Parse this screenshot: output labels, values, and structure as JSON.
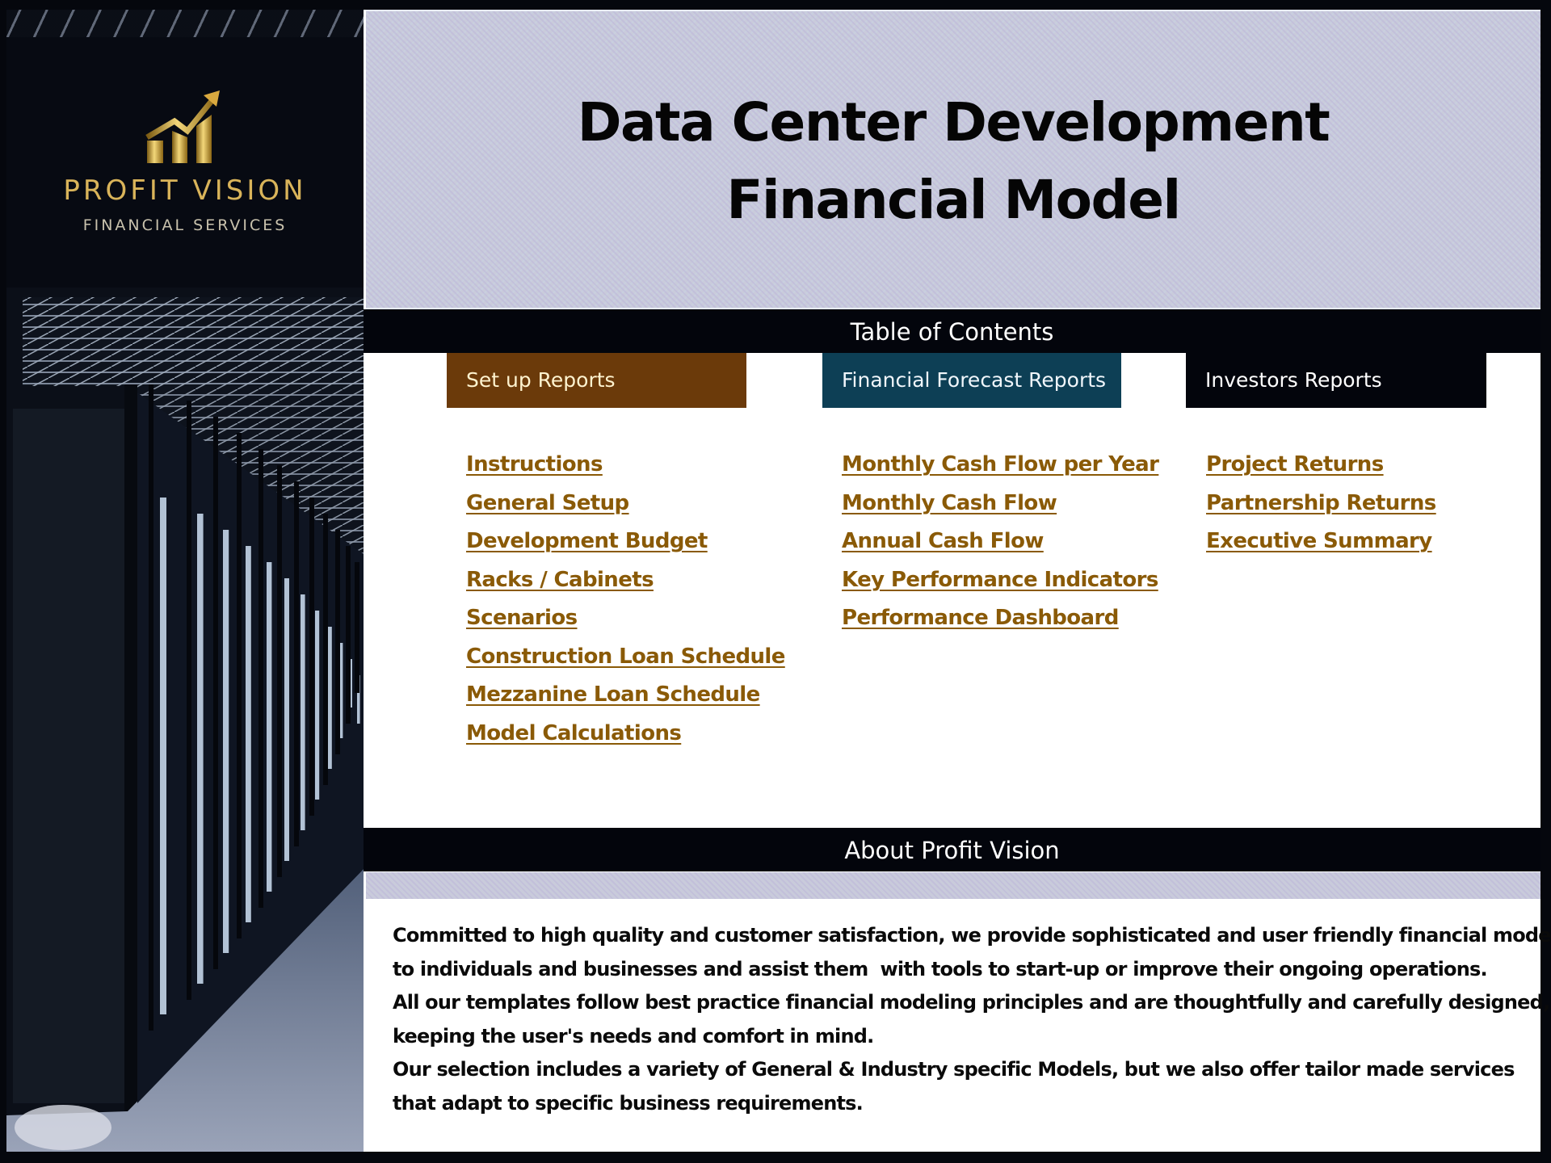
{
  "brand": {
    "name": "PROFIT VISION",
    "subtitle": "FINANCIAL SERVICES",
    "logo_icon": "gold-bar-chart-arrow-icon",
    "colors": {
      "gold": "#d9b45a",
      "panel": "#070a12"
    }
  },
  "header": {
    "title_line1": "Data Center Development",
    "title_line2": "Financial Model"
  },
  "toc": {
    "title": "Table of Contents",
    "categories": [
      {
        "label": "Set up Reports",
        "color": "#6b3a0a",
        "links": [
          "Instructions",
          "General Setup",
          "Development Budget",
          "Racks / Cabinets",
          "Scenarios",
          "Construction Loan Schedule",
          "Mezzanine Loan Schedule",
          "Model Calculations"
        ]
      },
      {
        "label": "Financial Forecast Reports",
        "color": "#0d3f55",
        "links": [
          "Monthly Cash Flow per Year",
          "Monthly Cash Flow",
          "Annual Cash Flow",
          "Key Performance Indicators",
          "Performance Dashboard"
        ]
      },
      {
        "label": "Investors Reports",
        "color": "#03050c",
        "links": [
          "Project Returns",
          "Partnership Returns",
          "Executive Summary"
        ]
      }
    ],
    "link_color": "#8a5a07"
  },
  "about": {
    "title": "About Profit Vision",
    "lines": [
      "Committed to high quality and customer satisfaction, we provide sophisticated and user friendly financial models",
      "to individuals and businesses and assist them  with tools to start-up or improve their ongoing operations.",
      "All our templates follow best practice financial modeling principles and are thoughtfully and carefully designed,",
      "keeping the user's needs and comfort in mind.",
      "Our selection includes a variety of General & Industry specific Models, but we also offer tailor made services",
      "that adapt to specific business requirements."
    ]
  },
  "images": {
    "side_photo": "data-center-server-aisle-photo"
  }
}
